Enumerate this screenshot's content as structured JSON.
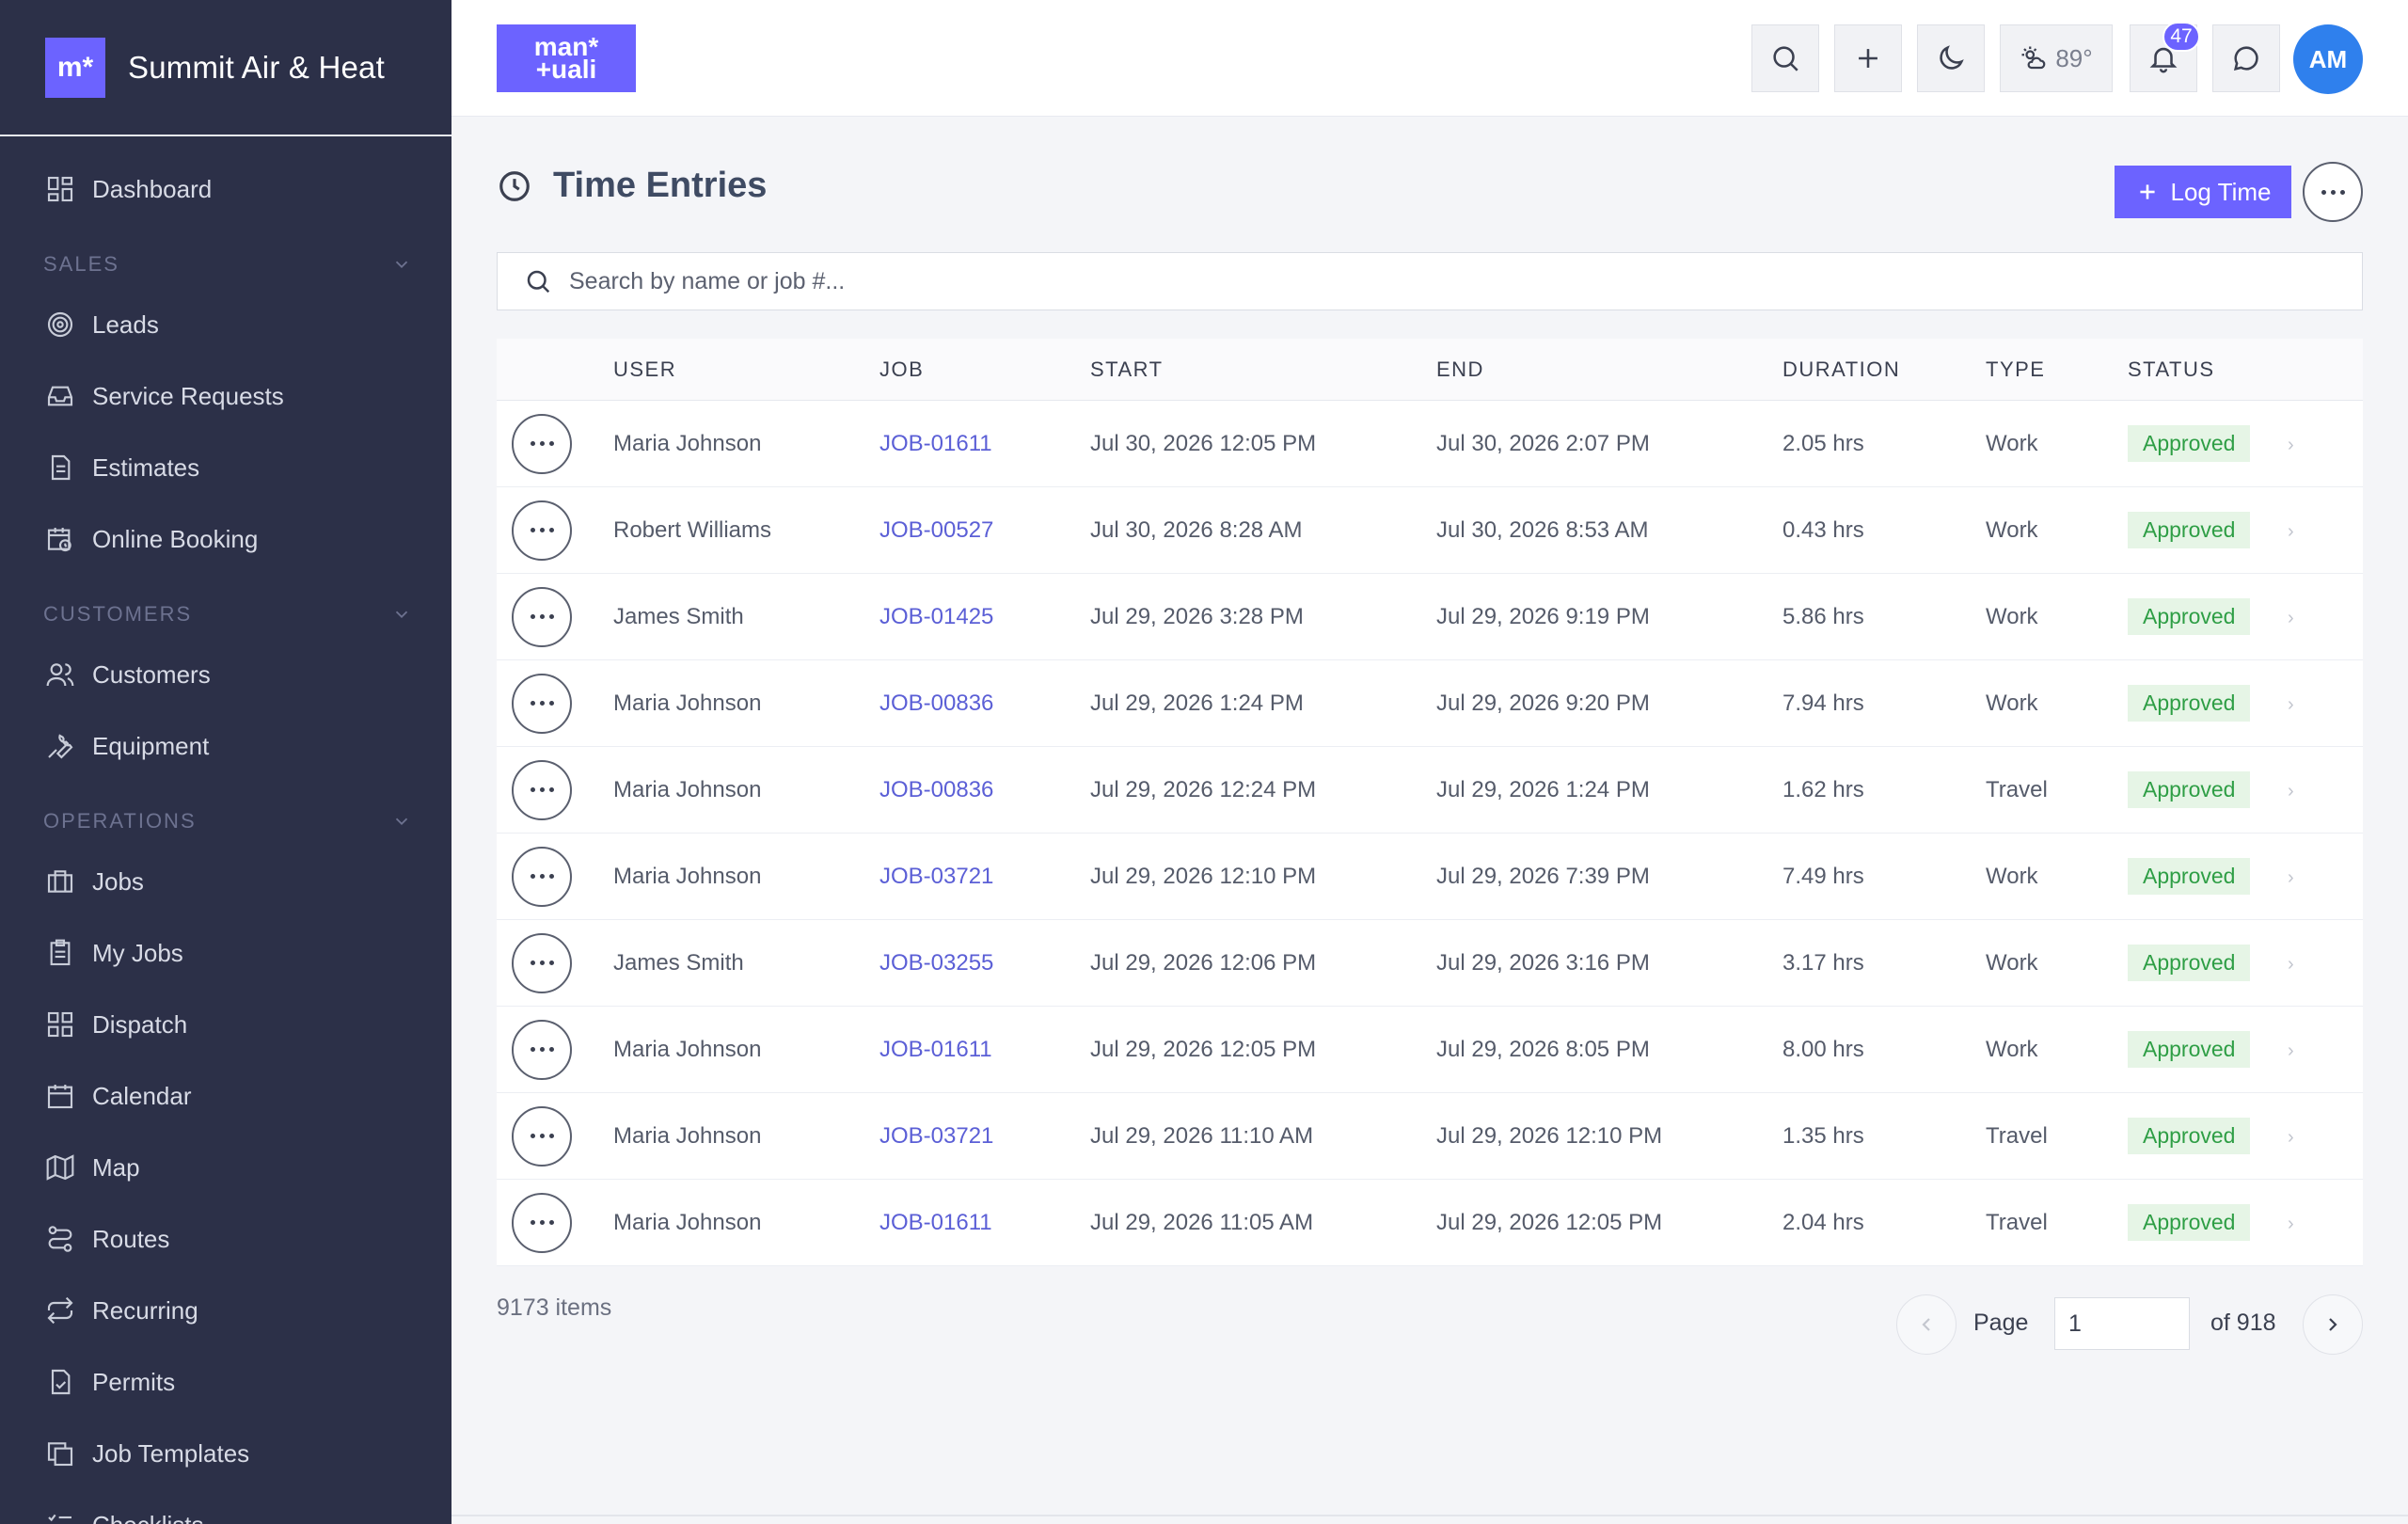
{
  "brand": {
    "logo_text": "m*",
    "name": "Summit Air & Heat"
  },
  "topbar": {
    "logo_line1": "man*",
    "logo_line2": "+uali",
    "weather": "89°",
    "notifications_count": "47",
    "avatar_initials": "AM"
  },
  "sidebar": {
    "dashboard": "Dashboard",
    "sections": {
      "sales": "SALES",
      "customers": "CUSTOMERS",
      "operations": "OPERATIONS"
    },
    "sales_items": [
      "Leads",
      "Service Requests",
      "Estimates",
      "Online Booking"
    ],
    "customer_items": [
      "Customers",
      "Equipment"
    ],
    "operation_items": [
      "Jobs",
      "My Jobs",
      "Dispatch",
      "Calendar",
      "Map",
      "Routes",
      "Recurring",
      "Permits",
      "Job Templates",
      "Checklists"
    ]
  },
  "page": {
    "title": "Time Entries",
    "log_time_label": "Log Time",
    "search_placeholder": "Search by name or job #..."
  },
  "table": {
    "columns": [
      "USER",
      "JOB",
      "START",
      "END",
      "DURATION",
      "TYPE",
      "STATUS"
    ],
    "rows": [
      {
        "user": "Maria Johnson",
        "job": "JOB-01611",
        "start": "Jul 30, 2026 12:05 PM",
        "end": "Jul 30, 2026 2:07 PM",
        "duration": "2.05 hrs",
        "type": "Work",
        "status": "Approved"
      },
      {
        "user": "Robert Williams",
        "job": "JOB-00527",
        "start": "Jul 30, 2026 8:28 AM",
        "end": "Jul 30, 2026 8:53 AM",
        "duration": "0.43 hrs",
        "type": "Work",
        "status": "Approved"
      },
      {
        "user": "James Smith",
        "job": "JOB-01425",
        "start": "Jul 29, 2026 3:28 PM",
        "end": "Jul 29, 2026 9:19 PM",
        "duration": "5.86 hrs",
        "type": "Work",
        "status": "Approved"
      },
      {
        "user": "Maria Johnson",
        "job": "JOB-00836",
        "start": "Jul 29, 2026 1:24 PM",
        "end": "Jul 29, 2026 9:20 PM",
        "duration": "7.94 hrs",
        "type": "Work",
        "status": "Approved"
      },
      {
        "user": "Maria Johnson",
        "job": "JOB-00836",
        "start": "Jul 29, 2026 12:24 PM",
        "end": "Jul 29, 2026 1:24 PM",
        "duration": "1.62 hrs",
        "type": "Travel",
        "status": "Approved"
      },
      {
        "user": "Maria Johnson",
        "job": "JOB-03721",
        "start": "Jul 29, 2026 12:10 PM",
        "end": "Jul 29, 2026 7:39 PM",
        "duration": "7.49 hrs",
        "type": "Work",
        "status": "Approved"
      },
      {
        "user": "James Smith",
        "job": "JOB-03255",
        "start": "Jul 29, 2026 12:06 PM",
        "end": "Jul 29, 2026 3:16 PM",
        "duration": "3.17 hrs",
        "type": "Work",
        "status": "Approved"
      },
      {
        "user": "Maria Johnson",
        "job": "JOB-01611",
        "start": "Jul 29, 2026 12:05 PM",
        "end": "Jul 29, 2026 8:05 PM",
        "duration": "8.00 hrs",
        "type": "Work",
        "status": "Approved"
      },
      {
        "user": "Maria Johnson",
        "job": "JOB-03721",
        "start": "Jul 29, 2026 11:10 AM",
        "end": "Jul 29, 2026 12:10 PM",
        "duration": "1.35 hrs",
        "type": "Travel",
        "status": "Approved"
      },
      {
        "user": "Maria Johnson",
        "job": "JOB-01611",
        "start": "Jul 29, 2026 11:05 AM",
        "end": "Jul 29, 2026 12:05 PM",
        "duration": "2.04 hrs",
        "type": "Travel",
        "status": "Approved"
      }
    ]
  },
  "footer": {
    "items_count": "9173 items",
    "page_label": "Page",
    "page_value": "1",
    "of_total": "of 918"
  },
  "colors": {
    "sidebar_bg": "#2c3048",
    "accent": "#6c63ff",
    "avatar": "#2f80ed",
    "status_approved": "#2e9e45"
  }
}
